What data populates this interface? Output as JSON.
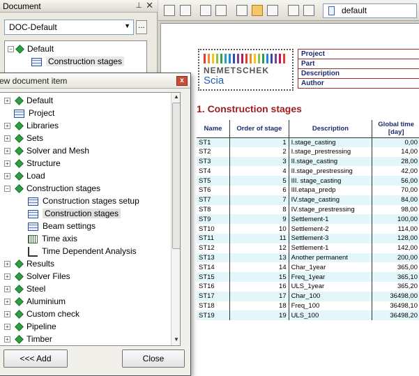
{
  "document_panel": {
    "title": "Document",
    "selected_document": "DOC-Default",
    "more_button": "...",
    "tree": [
      {
        "label": "Default"
      },
      {
        "label": "Construction stages"
      }
    ]
  },
  "toolbar": {
    "combo_value": "default"
  },
  "report": {
    "logo_name": "NEMETSCHEK",
    "logo_sub": "Scia",
    "header_fields": [
      "Project",
      "Part",
      "Description",
      "Author"
    ],
    "section_title": "1. Construction stages",
    "columns": [
      "Name",
      "Order of stage",
      "Description",
      "Global time [day]"
    ],
    "rows": [
      [
        "ST1",
        "1",
        "I.stage_casting",
        "0,00"
      ],
      [
        "ST2",
        "2",
        "I.stage_prestressing",
        "14,00"
      ],
      [
        "ST3",
        "3",
        "II.stage_casting",
        "28,00"
      ],
      [
        "ST4",
        "4",
        "II.stage_prestressing",
        "42,00"
      ],
      [
        "ST5",
        "5",
        "III. stage_casting",
        "56,00"
      ],
      [
        "ST6",
        "6",
        "III.etapa_predp",
        "70,00"
      ],
      [
        "ST7",
        "7",
        "IV.stage_casting",
        "84,00"
      ],
      [
        "ST8",
        "8",
        "IV.stage_prestressing",
        "98,00"
      ],
      [
        "ST9",
        "9",
        "Settlement-1",
        "100,00"
      ],
      [
        "ST10",
        "10",
        "Settlement-2",
        "114,00"
      ],
      [
        "ST11",
        "11",
        "Settlement-3",
        "128,00"
      ],
      [
        "ST12",
        "12",
        "Settlement-1",
        "142,00"
      ],
      [
        "ST13",
        "13",
        "Another permanent",
        "200,00"
      ],
      [
        "ST14",
        "14",
        "Char_1year",
        "365,00"
      ],
      [
        "ST15",
        "15",
        "Freq_1year",
        "365,10"
      ],
      [
        "ST16",
        "16",
        "ULS_1year",
        "365,20"
      ],
      [
        "ST17",
        "17",
        "Char_100",
        "36498,00"
      ],
      [
        "ST18",
        "18",
        "Freq_100",
        "36498,10"
      ],
      [
        "ST19",
        "19",
        "ULS_100",
        "36498,20"
      ]
    ]
  },
  "dialog": {
    "title": "ew document item",
    "close_glyph": "x",
    "add_button": "<<< Add",
    "close_button": "Close",
    "items": [
      {
        "label": "Default",
        "icon": "diamond",
        "level": 0,
        "expander": "+"
      },
      {
        "label": "Project",
        "icon": "grid",
        "level": 0,
        "expander": ""
      },
      {
        "label": "Libraries",
        "icon": "diamond",
        "level": 0,
        "expander": "+"
      },
      {
        "label": "Sets",
        "icon": "diamond",
        "level": 0,
        "expander": "+"
      },
      {
        "label": "Solver and Mesh",
        "icon": "diamond",
        "level": 0,
        "expander": "+"
      },
      {
        "label": "Structure",
        "icon": "diamond",
        "level": 0,
        "expander": "+"
      },
      {
        "label": "Load",
        "icon": "diamond",
        "level": 0,
        "expander": "+"
      },
      {
        "label": "Construction stages",
        "icon": "diamond",
        "level": 0,
        "expander": "−"
      },
      {
        "label": "Construction stages setup",
        "icon": "grid",
        "level": 1,
        "expander": ""
      },
      {
        "label": "Construction stages",
        "icon": "grid",
        "level": 1,
        "expander": "",
        "selected": true
      },
      {
        "label": "Beam settings",
        "icon": "grid",
        "level": 1,
        "expander": ""
      },
      {
        "label": "Time axis",
        "icon": "time",
        "level": 1,
        "expander": ""
      },
      {
        "label": "Time Dependent Analysis",
        "icon": "tda",
        "level": 1,
        "expander": ""
      },
      {
        "label": "Results",
        "icon": "diamond",
        "level": 0,
        "expander": "+"
      },
      {
        "label": "Solver Files",
        "icon": "diamond",
        "level": 0,
        "expander": "+"
      },
      {
        "label": "Steel",
        "icon": "diamond",
        "level": 0,
        "expander": "+"
      },
      {
        "label": "Aluminium",
        "icon": "diamond",
        "level": 0,
        "expander": "+"
      },
      {
        "label": "Custom check",
        "icon": "diamond",
        "level": 0,
        "expander": "+"
      },
      {
        "label": "Pipeline",
        "icon": "diamond",
        "level": 0,
        "expander": "+"
      },
      {
        "label": "Timber",
        "icon": "diamond",
        "level": 0,
        "expander": "+"
      }
    ]
  }
}
